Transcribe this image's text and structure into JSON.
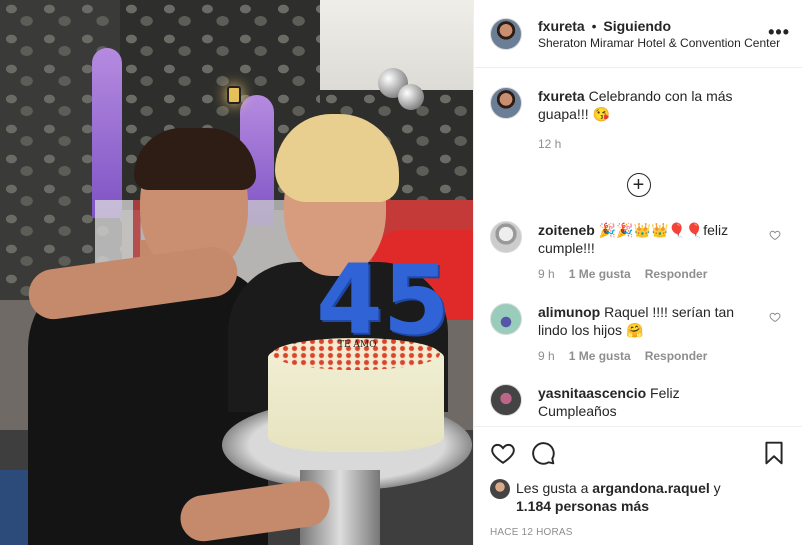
{
  "header": {
    "username": "fxureta",
    "separator": "•",
    "follow_status": "Siguiendo",
    "location": "Sheraton Miramar Hotel & Convention Center",
    "more_icon": "more-horizontal-icon"
  },
  "photo": {
    "candle_number": "45",
    "topper_text": "TE AMO"
  },
  "caption": {
    "username": "fxureta",
    "text": " Celebrando con la más guapa!!! 😘",
    "time": "12 h"
  },
  "load_more_icon": "plus-circle-icon",
  "comments": [
    {
      "username": "zoiteneb",
      "text": " 🎉🎉👑👑🎈🎈feliz cumple!!!",
      "time": "9 h",
      "likes": "1 Me gusta",
      "reply": "Responder"
    },
    {
      "username": "alimunop",
      "text": " Raquel !!!! serían tan lindo los hijos 🤗",
      "time": "9 h",
      "likes": "1 Me gusta",
      "reply": "Responder"
    },
    {
      "username": "yasnitaascencio",
      "text": " Feliz Cumpleaños"
    }
  ],
  "footer": {
    "likes_prefix": "Les gusta a ",
    "likes_user": "argandona.raquel",
    "likes_and": " y",
    "likes_more": "1.184 personas más",
    "time_ago": "HACE 12 HORAS"
  },
  "colors": {
    "candle": "#2f63d6",
    "text": "#262626",
    "muted": "#8e8e8e"
  }
}
